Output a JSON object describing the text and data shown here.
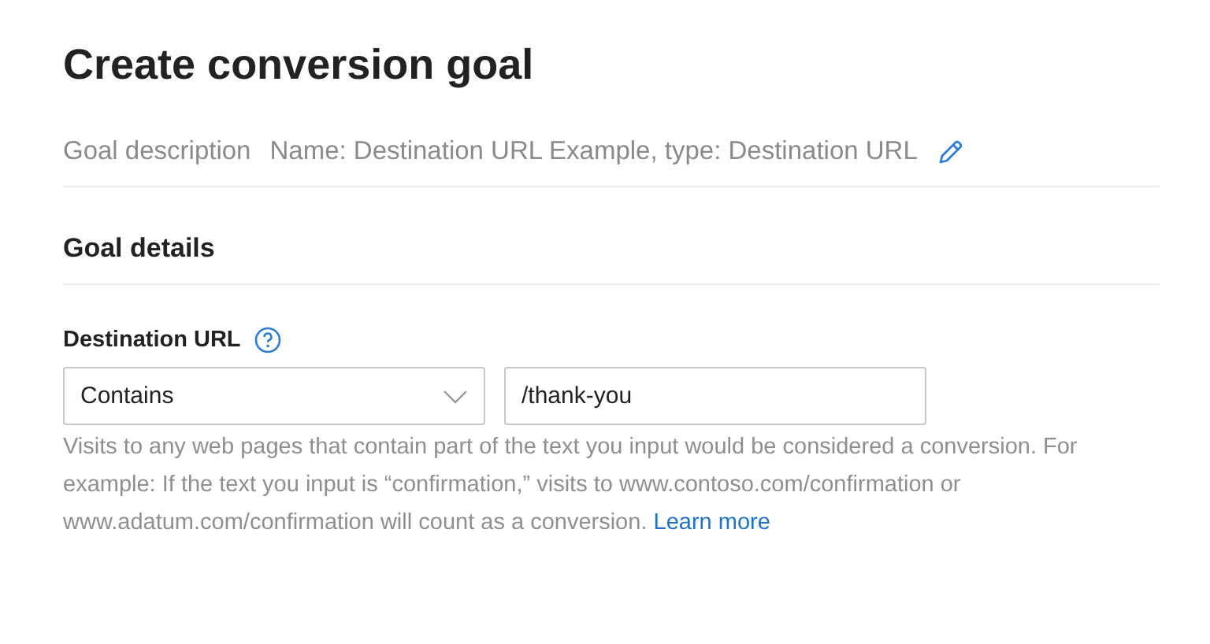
{
  "title": "Create conversion goal",
  "goal_description": {
    "label": "Goal description",
    "value": "Name: Destination URL Example, type: Destination URL"
  },
  "section": {
    "title": "Goal details"
  },
  "field": {
    "label": "Destination URL",
    "dropdown": {
      "value": "Contains"
    },
    "input": {
      "value": "/thank-you"
    },
    "help": "Visits to any web pages that contain part of the text you input would be considered a conversion. For example: If the text you input is “confirmation,” visits to www.contoso.com/confirmation or www.adatum.com/confirmation will count as a conversion.",
    "link": "Learn more"
  }
}
